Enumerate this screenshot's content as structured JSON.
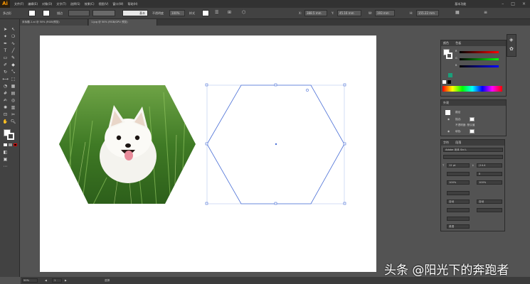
{
  "app": {
    "logo": "Ai"
  },
  "menubar": {
    "items": [
      "文件(F)",
      "编辑(E)",
      "对象(O)",
      "文字(T)",
      "选择(S)",
      "效果(C)",
      "视图(V)",
      "窗口(W)",
      "帮助(H)"
    ],
    "right_label": "基本功能"
  },
  "control_bar": {
    "selection_label": "多边形",
    "stroke_label": "描边",
    "stroke_profile": "基本",
    "opacity_label": "不透明度",
    "opacity_value": "100%",
    "style_label": "样式",
    "x_value": "388.5 mm",
    "y_value": "45.16 mm",
    "w_value": "193 mm",
    "h_value": "155.22 mm"
  },
  "tabs": [
    {
      "label": "未标题-1.ai @ 50% (RGB/预览)",
      "active": false
    },
    {
      "label": "1.jpg @ 50% (RGB/GPU 预览)",
      "active": true
    }
  ],
  "panels": {
    "color": {
      "tab1": "颜色",
      "tab2": "色板",
      "channels": [
        "R",
        "G",
        "B"
      ]
    },
    "layers": {
      "title": "外观",
      "row1": "路径",
      "row2": "描边:",
      "row3": "不透明度: 默认值",
      "row4": "填色:"
    },
    "character": {
      "tab1": "字符",
      "tab2": "段落",
      "font_family": "Adobe 宋体 Std L",
      "font_size": "12 pt",
      "leading": "(14.4",
      "tracking": "0",
      "scale_h": "100%",
      "scale_v": "100%",
      "auto1": "自动",
      "auto2": "自动",
      "lang": "英语"
    }
  },
  "statusbar": {
    "zoom": "50%",
    "page": "1",
    "tool": "选择"
  },
  "watermark": "头条 @阳光下的奔跑者",
  "colors": {
    "accent_orange": "#ff9a00",
    "selection_blue": "#4a6fd6",
    "ui_dark": "#424242"
  }
}
